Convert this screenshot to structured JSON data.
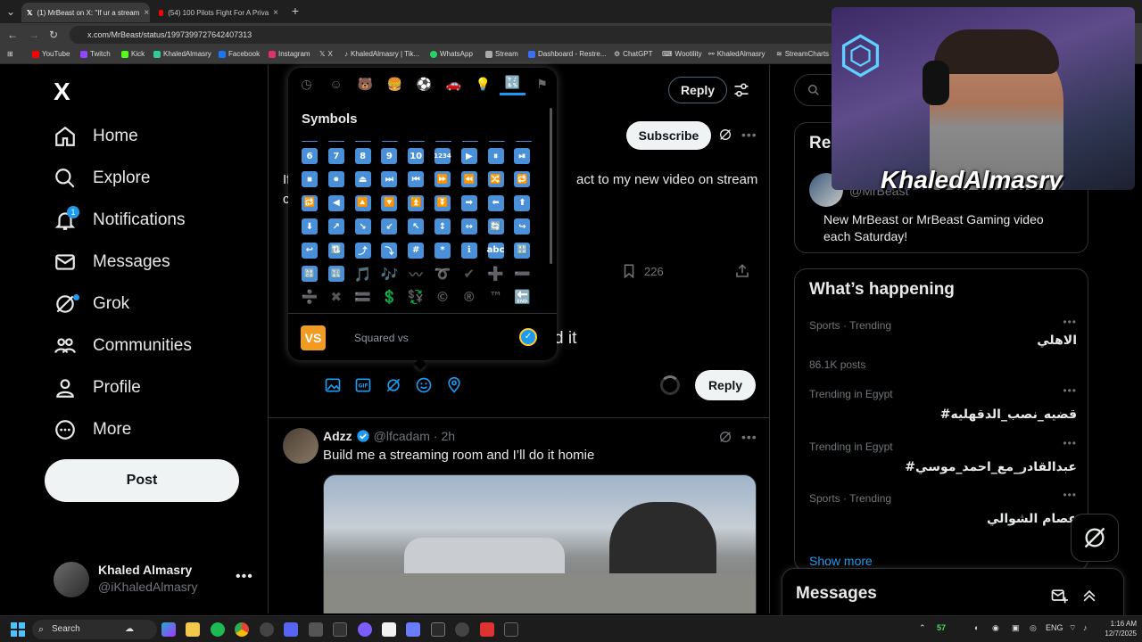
{
  "browser": {
    "tabs": [
      {
        "title": "(1) MrBeast on X: \"If ur a stream",
        "active": true
      },
      {
        "title": "(54) 100 Pilots Fight For A Priva",
        "active": false
      }
    ],
    "new_tab": "+",
    "url": "x.com/MrBeast/status/1997399727642407313",
    "bookmarks": [
      "YouTube",
      "Twitch",
      "Kick",
      "KhaledAlmasry",
      "Facebook",
      "Instagram",
      "X",
      "KhaledAlmasry | Tik...",
      "WhatsApp",
      "Stream",
      "Dashboard - Restre...",
      "ChatGPT",
      "Wootility",
      "KhaledAlmasry",
      "StreamCharts"
    ]
  },
  "sidebar": {
    "logo": "X",
    "items": [
      {
        "label": "Home"
      },
      {
        "label": "Explore"
      },
      {
        "label": "Notifications",
        "badge": "1"
      },
      {
        "label": "Messages"
      },
      {
        "label": "Grok"
      },
      {
        "label": "Communities"
      },
      {
        "label": "Profile"
      },
      {
        "label": "More"
      }
    ],
    "post_label": "Post",
    "account": {
      "name": "Khaled Almasry",
      "handle": "@iKhaledAlmasry"
    }
  },
  "main": {
    "reply_top_label": "Reply",
    "subscribe_label": "Subscribe",
    "tweet1_text_partial": "act to my new video on stream",
    "tweet1_text_prefix": "If",
    "tweet1_line2_prefix": "c",
    "bookmark_count": "226",
    "compose_text_tail": "d it",
    "reply_label": "Reply",
    "tweet2": {
      "name": "Adzz",
      "handle": "@lfcadam",
      "time": "· 2h",
      "text": "Build me a streaming room and I’ll do it homie"
    }
  },
  "emoji_picker": {
    "section_title": "Symbols",
    "preview_name": "Squared vs",
    "preview_symbol": "VS",
    "rows": [
      [
        "6",
        "7",
        "8",
        "9",
        "10",
        "1234",
        "▶",
        "⏸",
        "⏯"
      ],
      [
        "⏹",
        "⏺",
        "⏏",
        "⏭",
        "⏮",
        "⏩",
        "⏪",
        "🔀",
        "🔁"
      ],
      [
        "🔂",
        "◀",
        "🔼",
        "🔽",
        "⏫",
        "⏬",
        "➡",
        "⬅",
        "⬆"
      ],
      [
        "⬇",
        "↗",
        "↘",
        "↙",
        "↖",
        "↕",
        "↔",
        "🔄",
        "↪"
      ],
      [
        "↩",
        "🔃",
        "⤴",
        "⤵",
        "#",
        "*",
        "ℹ",
        "abc",
        "🔡"
      ],
      [
        "🔠",
        "🔣",
        "🎵",
        "🎶",
        "〰",
        "➰",
        "✔",
        "➕",
        "➖"
      ],
      [
        "➗",
        "✖",
        "🟰",
        "💲",
        "💱",
        "©",
        "®",
        "™",
        "🔚"
      ]
    ]
  },
  "right": {
    "search_placeholder": "S",
    "relevant_title": "Re",
    "relevant_handle": "@MrBeast",
    "relevant_bio": "New MrBeast or MrBeast Gaming video each Saturday!",
    "whats_happening": "What’s happening",
    "trends": [
      {
        "meta": "Sports · Trending",
        "name": "الاهلي",
        "count": "86.1K posts"
      },
      {
        "meta": "Trending in Egypt",
        "name": "#قضيه_نصب_الدقهليه",
        "count": ""
      },
      {
        "meta": "Trending in Egypt",
        "name": "#عبدالقادر_مع_احمد_موسي",
        "count": ""
      },
      {
        "meta": "Sports · Trending",
        "name": "عصام الشوالي",
        "count": ""
      }
    ],
    "show_more": "Show more",
    "messages_title": "Messages"
  },
  "webcam": {
    "overlay_name": "KhaledAlmasry"
  },
  "taskbar": {
    "search_label": "Search",
    "tray_number": "57",
    "language": "ENG",
    "time": "1:16 AM",
    "date": "12/7/2025"
  },
  "colors": {
    "accent": "#1d9bf0",
    "symbol_blue": "#4a90d9",
    "vs_orange": "#f29b23"
  }
}
